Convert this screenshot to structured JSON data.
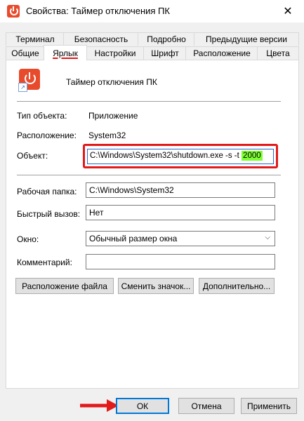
{
  "window": {
    "title": "Свойства: Таймер отключения ПК",
    "close_glyph": "✕"
  },
  "tabs_back": [
    "Терминал",
    "Безопасность",
    "Подробно",
    "Предыдущие версии"
  ],
  "tabs_front": [
    "Общие",
    "Ярлык",
    "Настройки",
    "Шрифт",
    "Расположение",
    "Цвета"
  ],
  "active_tab": "Ярлык",
  "app": {
    "name": "Таймер отключения ПК",
    "shortcut_glyph": "↗"
  },
  "props": {
    "type_label": "Тип объекта:",
    "type_value": "Приложение",
    "location_label": "Расположение:",
    "location_value": "System32",
    "object_label": "Объект:",
    "object_value_prefix": "C:\\Windows\\System32\\shutdown.exe -s -t",
    "object_value_highlight": "2000",
    "workdir_label": "Рабочая папка:",
    "workdir_value": "C:\\Windows\\System32",
    "hotkey_label": "Быстрый вызов:",
    "hotkey_value": "Нет",
    "window_label": "Окно:",
    "window_value": "Обычный размер окна",
    "comment_label": "Комментарий:",
    "comment_value": ""
  },
  "panel_buttons": {
    "open_location": "Расположение файла",
    "change_icon": "Сменить значок...",
    "advanced": "Дополнительно..."
  },
  "dialog_buttons": {
    "ok": "ОК",
    "cancel": "Отмена",
    "apply": "Применить"
  },
  "colors": {
    "annotation_red": "#e21a1a",
    "highlight_green": "#7cff32",
    "icon_red": "#e84a2c"
  }
}
